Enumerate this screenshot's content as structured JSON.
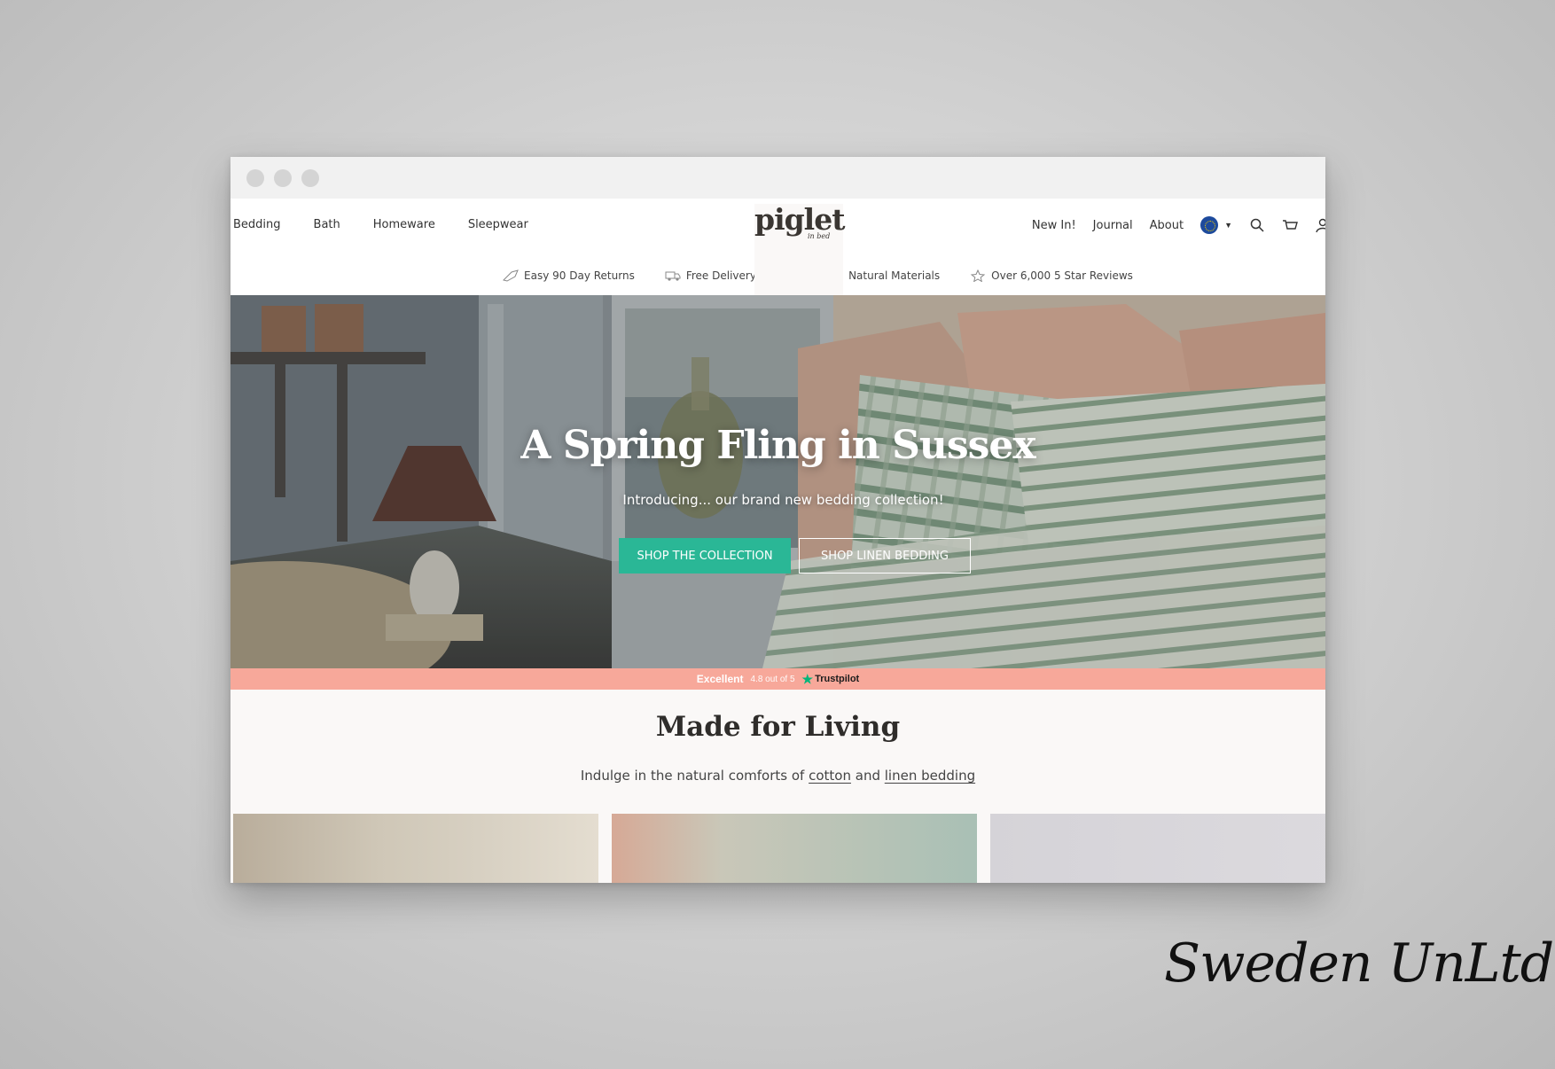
{
  "nav": {
    "left": [
      "Bedding",
      "Bath",
      "Homeware",
      "Sleepwear"
    ],
    "right": [
      "New In!",
      "Journal",
      "About"
    ]
  },
  "logo": {
    "text": "piglet",
    "subtext": "in bed"
  },
  "usps": [
    {
      "icon": "returns-icon",
      "label": "Easy 90 Day Returns"
    },
    {
      "icon": "delivery-icon",
      "label": "Free Delivery (+£50)"
    },
    {
      "icon": "leaf-icon",
      "label": "Natural Materials"
    },
    {
      "icon": "star-icon",
      "label": "Over 6,000 5 Star Reviews"
    }
  ],
  "hero": {
    "title": "A Spring Fling in Sussex",
    "subtitle": "Introducing... our brand new bedding collection!",
    "primary_cta": "SHOP THE COLLECTION",
    "secondary_cta": "SHOP LINEN BEDDING"
  },
  "trustpilot": {
    "rating_word": "Excellent",
    "score": "4.8 out of 5",
    "brand": "Trustpilot"
  },
  "section": {
    "title": "Made for Living",
    "intro_prefix": "Indulge in the natural comforts of",
    "link_cotton": "cotton",
    "intro_and": "and",
    "link_linen": "linen bedding"
  },
  "colors": {
    "primary_button": "#2ab796",
    "trust_bar": "#f7a89a",
    "text_dark": "#2f2d2b"
  },
  "watermark": "Sweden UnLtd"
}
